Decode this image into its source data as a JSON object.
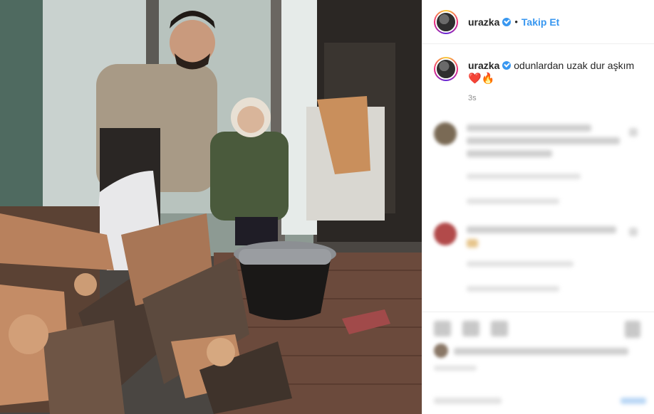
{
  "post": {
    "image_alt": "photo",
    "header": {
      "username": "urazka",
      "separator": "•",
      "follow_label": "Takip Et"
    },
    "caption": {
      "username": "urazka",
      "text": "odunlardan uzak dur aşkım",
      "emojis": "❤️🔥",
      "time": "3s"
    }
  },
  "colors": {
    "accent": "#3897f0",
    "text": "#262626",
    "muted": "#8e8e8e",
    "border": "#efefef"
  },
  "icons": [
    "verified-badge-icon",
    "heart-emoji-icon",
    "fire-emoji-icon"
  ]
}
